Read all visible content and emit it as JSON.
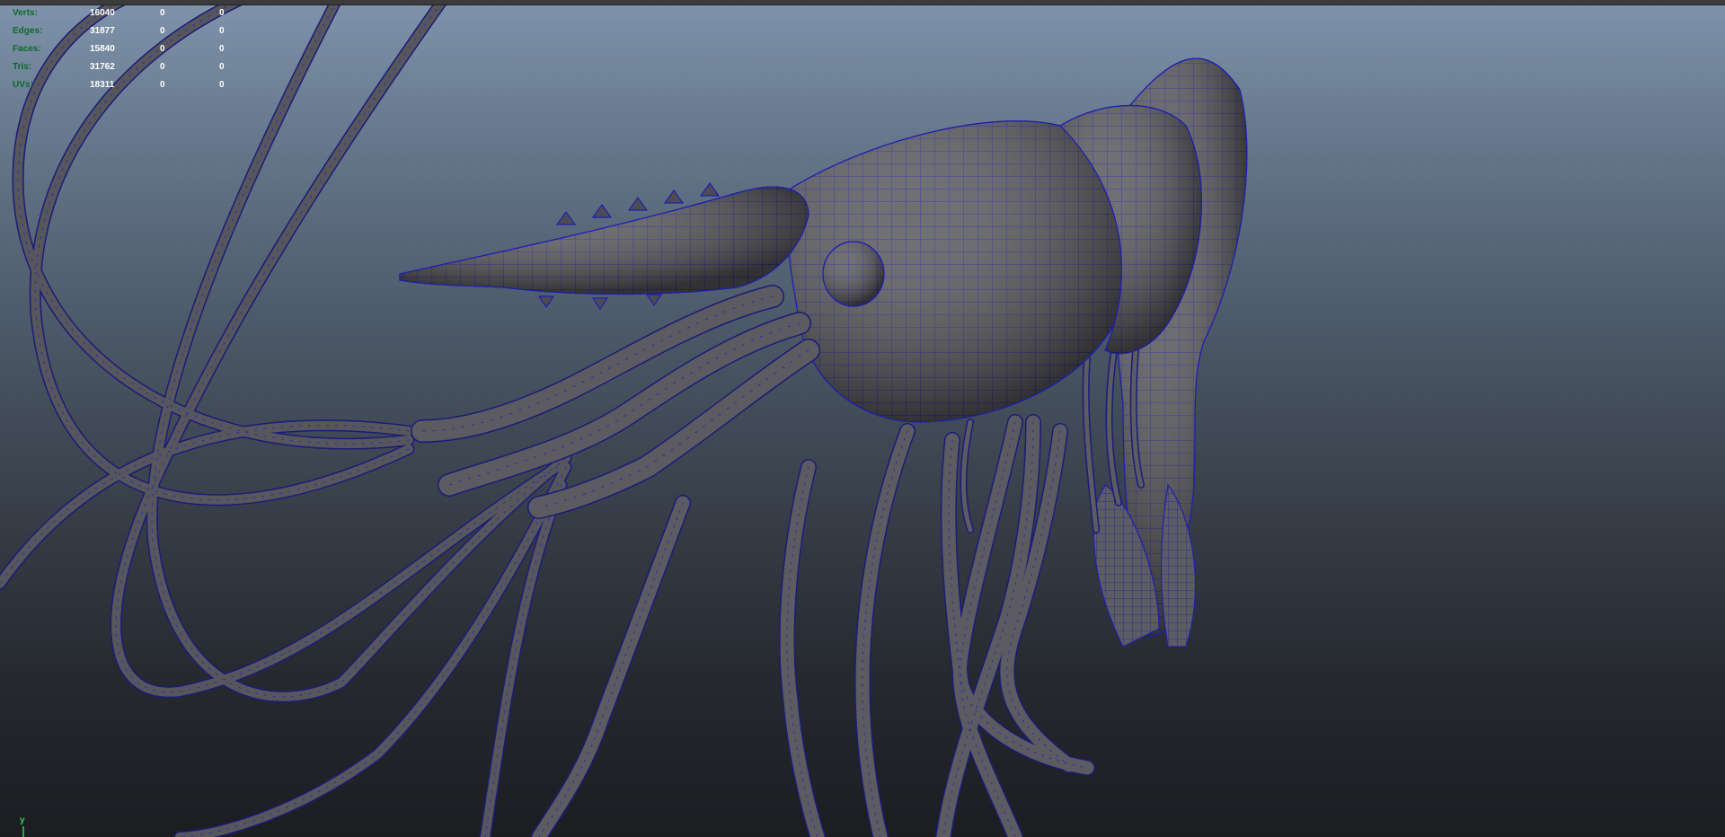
{
  "viewport": {
    "scene_subject": "shrimp-wireframe-model"
  },
  "hud": {
    "rows": [
      {
        "label": "Verts:",
        "total": "16040",
        "selected": "0",
        "components": "0"
      },
      {
        "label": "Edges:",
        "total": "31877",
        "selected": "0",
        "components": "0"
      },
      {
        "label": "Faces:",
        "total": "15840",
        "selected": "0",
        "components": "0"
      },
      {
        "label": "Tris:",
        "total": "31762",
        "selected": "0",
        "components": "0"
      },
      {
        "label": "UVs:",
        "total": "18311",
        "selected": "0",
        "components": "0"
      }
    ]
  },
  "axis": {
    "label": "y",
    "y_color": "#2fd44a"
  },
  "colors": {
    "mesh_fill": "#5a5a5e",
    "wire": "#1f1fb0",
    "hud_label": "#0c6b26",
    "hud_value": "#ffffff"
  }
}
